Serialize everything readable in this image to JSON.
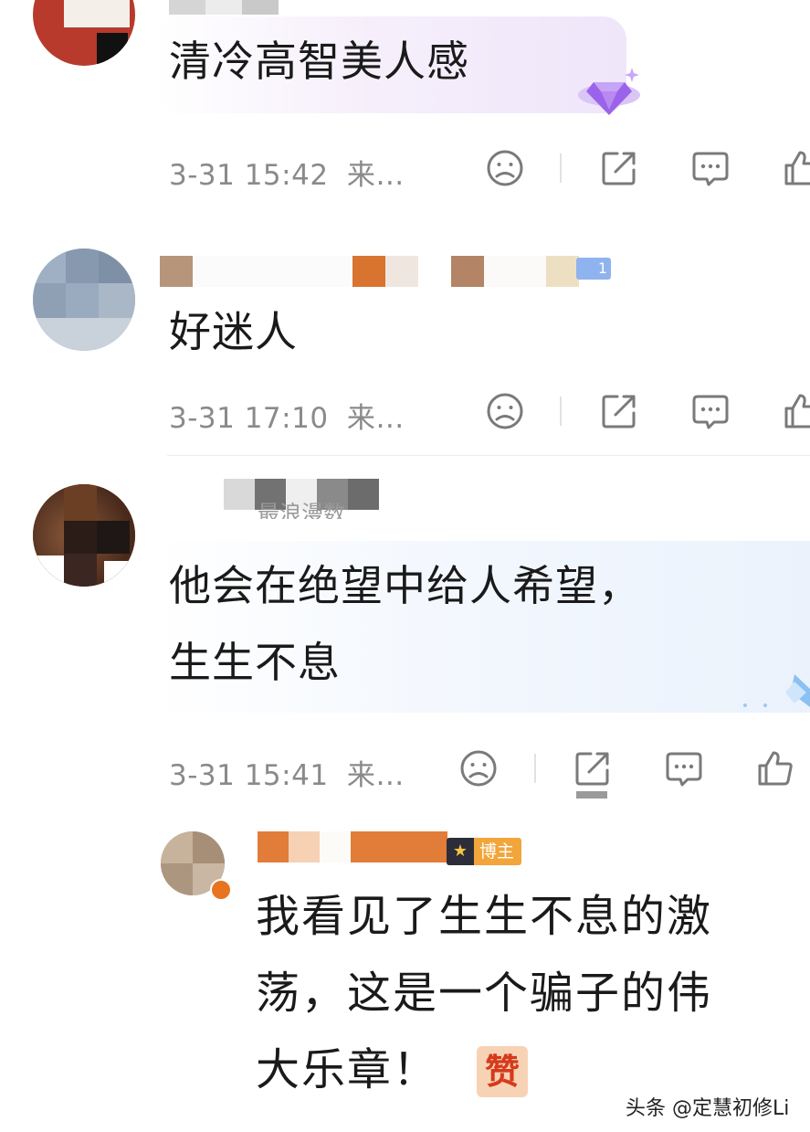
{
  "comments": [
    {
      "content": "清冷高智美人感",
      "time": "3-31 15:42",
      "source": "来…"
    },
    {
      "content": "好迷人",
      "time": "3-31 17:10",
      "source": "来…",
      "fan_badge": "1"
    },
    {
      "content_line1": "他会在绝望中给人希望，",
      "content_line2": "生生不息",
      "time": "3-31 15:41",
      "source": "来…",
      "fan_label": "最浪漫数"
    }
  ],
  "reply": {
    "badge": "博主",
    "content_line1": "我看见了生生不息的激",
    "content_line2": "荡，这是一个骗子的伟",
    "content_line3": "大乐章！",
    "emoji": "赞"
  },
  "icons": {
    "dislike": "sad-face-icon",
    "share": "share-icon",
    "reply": "comment-icon",
    "like": "thumbs-up-icon"
  },
  "watermark": "头条 @定慧初修Li"
}
